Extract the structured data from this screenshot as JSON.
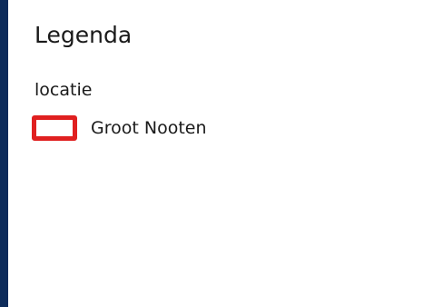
{
  "legend": {
    "title": "Legenda",
    "groups": [
      {
        "label": "locatie",
        "items": [
          {
            "label": "Groot Nooten",
            "symbol": "outline-rectangle",
            "stroke_color": "#e02020",
            "fill_color": "#ffffff"
          }
        ]
      }
    ]
  },
  "colors": {
    "frame": "#0d2b5a",
    "panel": "#ffffff",
    "text": "#1a1a1a"
  }
}
